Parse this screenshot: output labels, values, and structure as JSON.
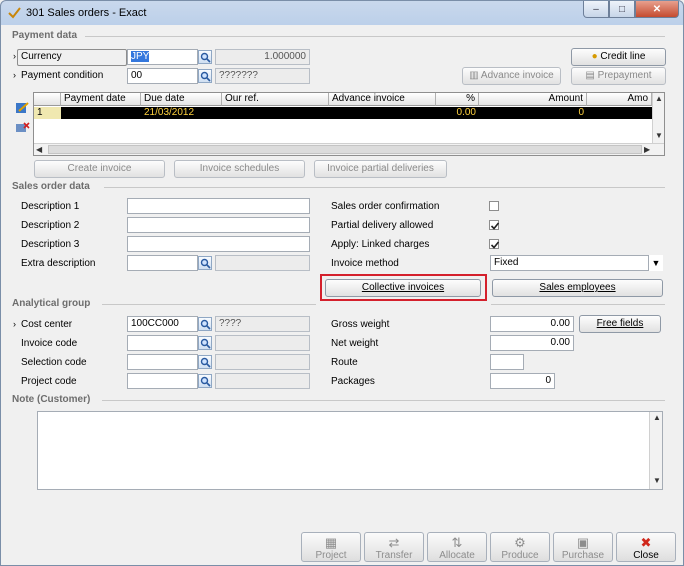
{
  "window": {
    "title": "301 Sales orders - Exact",
    "controls": [
      "–",
      "□",
      "✕"
    ]
  },
  "payment": {
    "section_title": "Payment data",
    "currency_label": "Currency",
    "currency_value": "JPY",
    "exchange_rate": "1.000000",
    "condition_label": "Payment condition",
    "condition_value": "00",
    "condition_desc": "???????",
    "credit_line_btn": "Credit line",
    "advance_invoice_btn": "Advance invoice",
    "prepayment_btn": "Prepayment",
    "grid": {
      "columns": [
        "Payment date",
        "Due date",
        "Our ref.",
        "Advance invoice",
        "%",
        "Amount",
        "Amo"
      ],
      "rows": [
        {
          "num": "1",
          "payment_date": "",
          "due_date": "21/03/2012",
          "our_ref": "",
          "advance_invoice": "",
          "percent": "0.00",
          "amount": "0",
          "amo": ""
        }
      ]
    },
    "create_invoice_btn": "Create invoice",
    "invoice_schedules_btn": "Invoice schedules",
    "invoice_partial_btn": "Invoice partial deliveries"
  },
  "sales_order": {
    "section_title": "Sales order data",
    "desc1_label": "Description 1",
    "desc1_value": "",
    "desc2_label": "Description 2",
    "desc2_value": "",
    "desc3_label": "Description 3",
    "desc3_value": "",
    "extra_desc_label": "Extra description",
    "extra_desc_value": "",
    "confirmation_label": "Sales order confirmation",
    "confirmation_checked": false,
    "partial_label": "Partial delivery allowed",
    "partial_checked": true,
    "linked_label": "Apply: Linked charges",
    "linked_checked": true,
    "invoice_method_label": "Invoice method",
    "invoice_method_value": "Fixed",
    "collective_btn": "Collective invoices",
    "sales_employees_btn": "Sales employees"
  },
  "analytical": {
    "section_title": "Analytical group",
    "cost_center_label": "Cost center",
    "cost_center_value": "100CC000",
    "cost_center_desc": "????",
    "invoice_code_label": "Invoice code",
    "selection_code_label": "Selection code",
    "project_code_label": "Project code",
    "gross_weight_label": "Gross weight",
    "gross_weight_value": "0.00",
    "net_weight_label": "Net weight",
    "net_weight_value": "0.00",
    "route_label": "Route",
    "route_value": "",
    "packages_label": "Packages",
    "packages_value": "0",
    "free_fields_btn": "Free fields"
  },
  "note": {
    "section_title": "Note (Customer)",
    "value": ""
  },
  "toolbar": {
    "project": "Project",
    "transfer": "Transfer",
    "allocate": "Allocate",
    "produce": "Produce",
    "purchase": "Purchase",
    "close": "Close"
  }
}
